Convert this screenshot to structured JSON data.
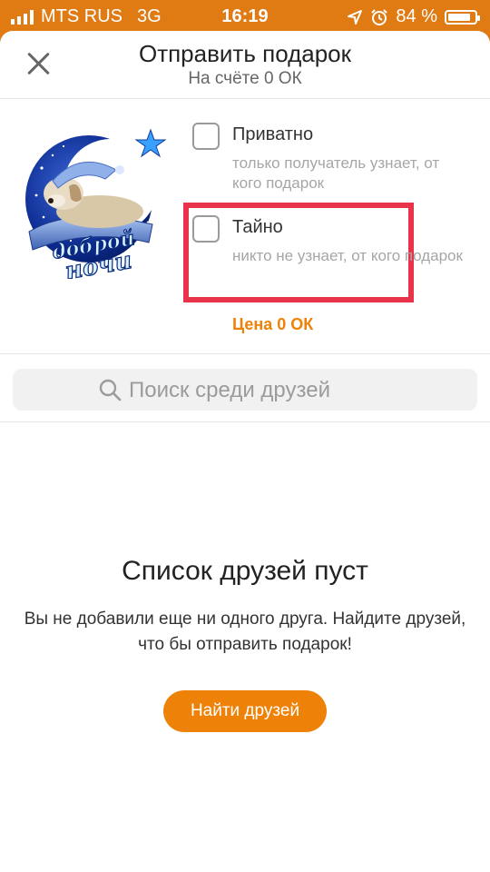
{
  "status_bar": {
    "carrier": "MTS RUS",
    "network": "3G",
    "time": "16:19",
    "battery_percent": "84 %",
    "battery_level": 0.84
  },
  "header": {
    "title": "Отправить подарок",
    "subtitle": "На счёте 0 ОК"
  },
  "gift": {
    "image_text_line1": "доброй",
    "image_text_line2": "ночи"
  },
  "options": {
    "private": {
      "label": "Приватно",
      "description": "только получатель узнает, от кого подарок",
      "checked": false
    },
    "secret": {
      "label": "Тайно",
      "description": "никто не узнает, от кого подарок",
      "checked": false
    }
  },
  "price_label": "Цена 0 ОК",
  "search": {
    "placeholder": "Поиск среди друзей"
  },
  "empty_state": {
    "title": "Список друзей пуст",
    "text": "Вы не добавили еще ни одного друга. Найдите друзей, что бы отправить подарок!",
    "button_label": "Найти друзей"
  },
  "colors": {
    "accent": "#ee8208",
    "highlight": "#e8334a"
  }
}
